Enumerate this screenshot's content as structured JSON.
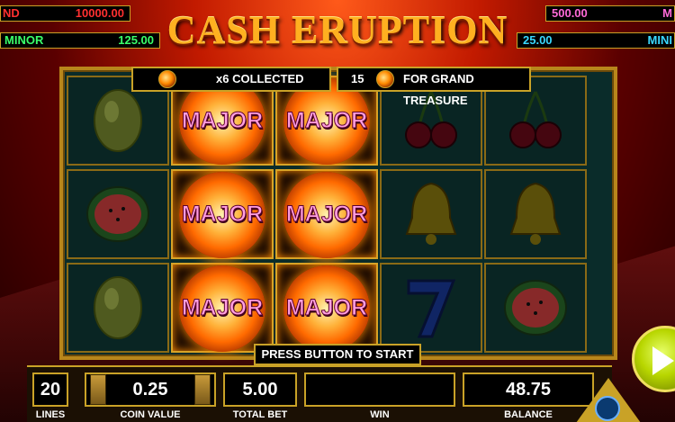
{
  "title": "CASH ERUPTION",
  "jackpots": {
    "left_top": {
      "label": "ND",
      "value": "10000.00"
    },
    "left_bottom": {
      "label": "MINOR",
      "value": "125.00"
    },
    "right_top": {
      "label": "M",
      "value": "500.00"
    },
    "right_bottom": {
      "label": "MINI",
      "value": "25.00"
    }
  },
  "info": {
    "collected": "x6 COLLECTED",
    "count": "15",
    "target": "FOR GRAND TREASURE"
  },
  "reels": {
    "orb_label": "MAJOR",
    "grid": [
      [
        "lemon",
        "fireball",
        "fireball",
        "cherries",
        "cherries"
      ],
      [
        "watermelon",
        "fireball",
        "fireball",
        "bell",
        "bell"
      ],
      [
        "lemon",
        "fireball",
        "fireball",
        "seven",
        "watermelon"
      ]
    ]
  },
  "prompt": "PRESS BUTTON TO START",
  "bottom": {
    "lines": {
      "value": "20",
      "label": "LINES"
    },
    "coin_value": {
      "value": "0.25",
      "label": "COIN VALUE"
    },
    "total_bet": {
      "value": "5.00",
      "label": "TOTAL BET"
    },
    "win": {
      "value": "",
      "label": "WIN"
    },
    "balance": {
      "value": "48.75",
      "label": "BALANCE"
    }
  },
  "colors": {
    "accent_gold": "#c9a227",
    "jackpot_red": "#ff2020",
    "jackpot_green": "#3aff6a",
    "jackpot_pink": "#ff6ad8",
    "jackpot_cyan": "#3ad8ff"
  }
}
